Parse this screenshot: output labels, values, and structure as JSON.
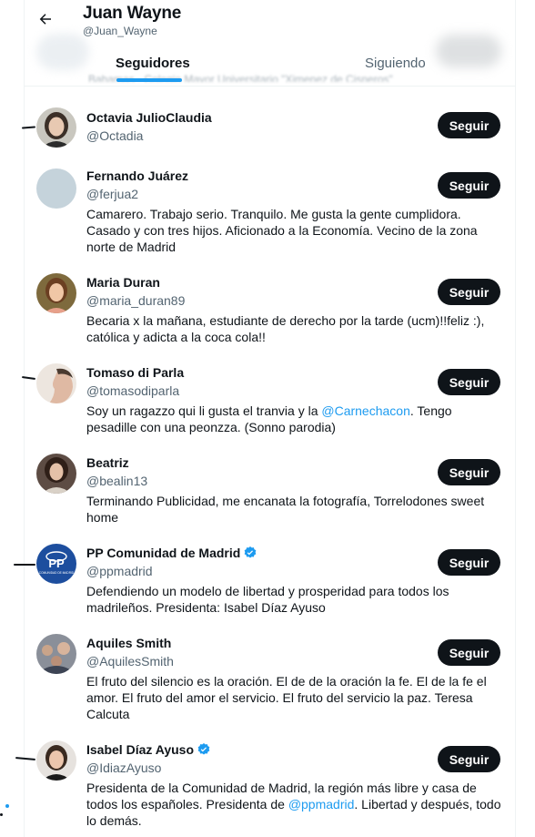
{
  "header": {
    "title": "Juan Wayne",
    "handle": "@Juan_Wayne",
    "blurred_text": "Bahamas · Colegio Mayor Universitario \"Ximenez de Cisneros\"",
    "tabs": [
      {
        "label": "Seguidores",
        "active": true
      },
      {
        "label": "Siguiendo",
        "active": false
      }
    ]
  },
  "colors": {
    "accent": "#1d9bf0",
    "text_primary": "#0f1419",
    "text_secondary": "#536471",
    "button_bg": "#0f1419",
    "button_text": "#ffffff"
  },
  "users": [
    {
      "name": "Octavia JulioClaudia",
      "handle": "@Octadia",
      "verified": false,
      "bio": "",
      "follow_label": "Seguir",
      "avatar_icon": "woman-avatar"
    },
    {
      "name": "Fernando Juárez",
      "handle": "@ferjua2",
      "verified": false,
      "bio": "Camarero. Trabajo serio. Tranquilo. Me gusta la gente cumplidora. Casado y con tres hijos. Aficionado a la Economía. Vecino de la zona norte de Madrid",
      "follow_label": "Seguir",
      "avatar_icon": "default-avatar"
    },
    {
      "name": "Maria Duran",
      "handle": "@maria_duran89",
      "verified": false,
      "bio": "Becaria x la mañana, estudiante de derecho por la tarde (ucm)!!feliz :), católica y adicta a la coca cola!!",
      "follow_label": "Seguir",
      "avatar_icon": "woman-avatar"
    },
    {
      "name": "Tomaso di Parla",
      "handle": "@tomasodiparla",
      "verified": false,
      "bio_parts": [
        "Soy un ragazzo qui li gusta el tranvia y la ",
        "@Carnechacon",
        ". Tengo pesadille con una peonzza. (Sonno parodia)"
      ],
      "follow_label": "Seguir",
      "avatar_icon": "man-profile-avatar"
    },
    {
      "name": "Beatriz",
      "handle": "@bealin13",
      "verified": false,
      "bio": "Terminando Publicidad, me encanata la fotografía, Torrelodones sweet home",
      "follow_label": "Seguir",
      "avatar_icon": "woman-avatar"
    },
    {
      "name": "PP Comunidad de Madrid",
      "handle": "@ppmadrid",
      "verified": true,
      "bio": "Defendiendo un modelo de libertad y prosperidad para todos los madrileños. Presidenta: Isabel Díaz Ayuso",
      "follow_label": "Seguir",
      "avatar_icon": "pp-logo",
      "logo_text": "PP",
      "logo_caption": "COMUNIDAD DE MADRID"
    },
    {
      "name": "Aquiles Smith",
      "handle": "@AquilesSmith",
      "verified": false,
      "bio": "El fruto del silencio es la oración. El de de la oración la fe. El de la fe el amor. El fruto del amor el servicio. El fruto del servicio la paz. Teresa Calcuta",
      "follow_label": "Seguir",
      "avatar_icon": "crowd-avatar"
    },
    {
      "name": "Isabel Díaz Ayuso",
      "handle": "@IdiazAyuso",
      "verified": true,
      "bio_parts": [
        "Presidenta de la Comunidad de Madrid, la región más libre y casa de todos los españoles. Presidenta de ",
        "@ppmadrid",
        ". Libertad y después, todo lo demás."
      ],
      "follow_label": "Seguir",
      "avatar_icon": "woman-avatar"
    }
  ]
}
